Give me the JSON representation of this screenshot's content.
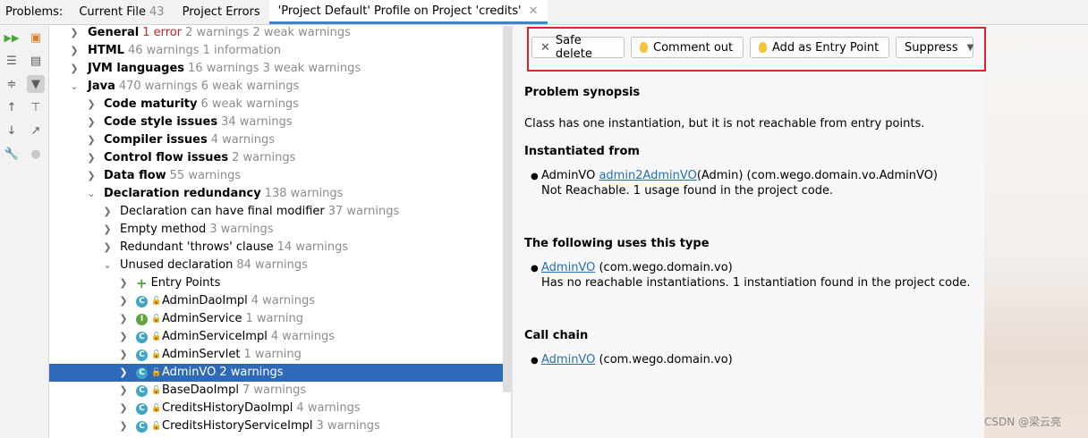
{
  "tabs": {
    "lead": "Problems:",
    "items": [
      {
        "label": "Current File",
        "count": "43"
      },
      {
        "label": "Project Errors",
        "count": ""
      },
      {
        "label": "'Project Default' Profile on Project 'credits'",
        "count": ""
      }
    ]
  },
  "tree": {
    "general": {
      "name": "General",
      "errors": "1 error",
      "rest": "2 warnings 2 weak warnings"
    },
    "html": {
      "name": "HTML",
      "rest": "46 warnings 1 information"
    },
    "jvm": {
      "name": "JVM languages",
      "rest": "16 warnings 3 weak warnings"
    },
    "java": {
      "name": "Java",
      "rest": "470 warnings 6 weak warnings"
    },
    "code_maturity": {
      "name": "Code maturity",
      "rest": "6 weak warnings"
    },
    "code_style": {
      "name": "Code style issues",
      "rest": "34 warnings"
    },
    "compiler": {
      "name": "Compiler issues",
      "rest": "4 warnings"
    },
    "control_flow": {
      "name": "Control flow issues",
      "rest": "2 warnings"
    },
    "data_flow": {
      "name": "Data flow",
      "rest": "55 warnings"
    },
    "decl_redundancy": {
      "name": "Declaration redundancy",
      "rest": "138 warnings"
    },
    "final_modifier": {
      "name": "Declaration can have final modifier",
      "rest": "37 warnings"
    },
    "empty_method": {
      "name": "Empty method",
      "rest": "3 warnings"
    },
    "redundant_throws": {
      "name": "Redundant 'throws' clause",
      "rest": "14 warnings"
    },
    "unused_decl": {
      "name": "Unused declaration",
      "rest": "84 warnings"
    },
    "entry_points": {
      "name": "Entry Points"
    },
    "classes": [
      {
        "name": "AdminDaoImpl",
        "rest": "4 warnings",
        "kind": "C"
      },
      {
        "name": "AdminService",
        "rest": "1 warning",
        "kind": "I"
      },
      {
        "name": "AdminServiceImpl",
        "rest": "4 warnings",
        "kind": "C"
      },
      {
        "name": "AdminServlet",
        "rest": "1 warning",
        "kind": "C"
      },
      {
        "name": "AdminVO",
        "rest": "2 warnings",
        "kind": "C"
      },
      {
        "name": "BaseDaoImpl",
        "rest": "7 warnings",
        "kind": "C"
      },
      {
        "name": "CreditsHistoryDaoImpl",
        "rest": "4 warnings",
        "kind": "C"
      },
      {
        "name": "CreditsHistoryServiceImpl",
        "rest": "3 warnings",
        "kind": "C"
      }
    ]
  },
  "actions": {
    "safe_delete": "Safe delete",
    "comment_out": "Comment out",
    "add_entry": "Add as Entry Point",
    "suppress": "Suppress"
  },
  "detail": {
    "synopsis_title": "Problem synopsis",
    "synopsis_text": "Class has one instantiation, but it is not reachable from entry points.",
    "inst_title": "Instantiated from",
    "inst_prefix": "AdminVO",
    "inst_link": "admin2AdminVO",
    "inst_suffix": "(Admin) (com.wego.domain.vo.AdminVO)",
    "inst_note": "Not Reachable. 1 usage found in the project code.",
    "uses_title": "The following uses this type",
    "uses_link": "AdminVO",
    "uses_suffix": "(com.wego.domain.vo)",
    "uses_note": "Has no reachable instantiations. 1 instantiation found in the project code.",
    "chain_title": "Call chain",
    "chain_link": "AdminVO",
    "chain_suffix": "(com.wego.domain.vo)"
  },
  "watermark": "CSDN @梁云亮"
}
